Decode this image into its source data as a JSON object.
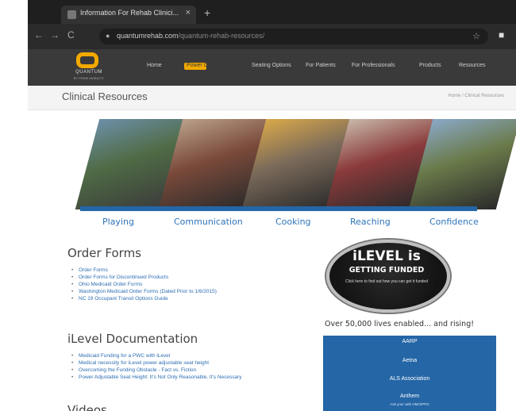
{
  "browser": {
    "tab_title": "Information For Rehab Clinici...",
    "tab_close": "×",
    "new_tab": "+",
    "back": "←",
    "forward": "→",
    "reload": "C",
    "url_domain": "quantumrehab.com",
    "url_path": "/quantum-rehab-resources/",
    "bookmark_star": "☆"
  },
  "site": {
    "logo_text": "QUANTUM",
    "logo_sub": "BY PRIDE MOBILITY",
    "nav": [
      "Home",
      "Power Chairs",
      "Seating Options",
      "For Patients",
      "For Professionals",
      "Products",
      "Resources"
    ],
    "page_title": "Clinical Resources",
    "breadcrumb": "Home  /  Clinical Resources"
  },
  "banner": {
    "labels": [
      "Playing",
      "Communication",
      "Cooking",
      "Reaching",
      "Confidence"
    ]
  },
  "order_forms": {
    "heading": "Order Forms",
    "items": [
      "Order Forms",
      "Order Forms for Discontinued Products",
      "Ohio Medicaid Order Forms",
      "Washington Medicaid Order Forms (Dated Prior to 1/6/2015)",
      "NC 19 Occupant Transit Options Guide"
    ]
  },
  "ilevel_docs": {
    "heading": "iLevel Documentation",
    "items": [
      "Medicaid Funding for a PWC with iLevel",
      "Medical necessity for iLevel power adjustable seat height",
      "Overcoming the Funding Obstacle - Fact vs. Fiction",
      "Power Adjustable Seat Height: It's Not Only Reasonable, It's Necessary"
    ]
  },
  "videos": {
    "heading": "Videos"
  },
  "badge": {
    "line1": "iLEVEL is",
    "line2": "GETTING FUNDED",
    "line3": "Click here to find out how you can get it funded"
  },
  "tagline": "Over 50,000 lives enabled... and rising!",
  "funders": [
    {
      "name": "AARP"
    },
    {
      "name": "Aetna"
    },
    {
      "name": "ALS Association"
    },
    {
      "name": "Anthem",
      "sub": "Ask your with HMO/PPO"
    }
  ],
  "colors": {
    "accent": "#f2a900",
    "link": "#2d6eb3",
    "funder_box": "#2466a6"
  }
}
